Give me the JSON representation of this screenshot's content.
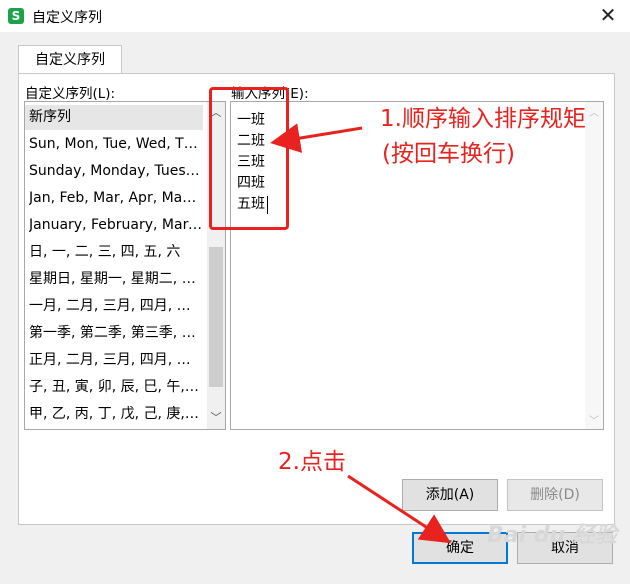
{
  "window": {
    "title": "自定义序列",
    "app_icon_glyph": "S"
  },
  "tabs": [
    {
      "label": "自定义序列"
    }
  ],
  "list_section": {
    "label": "自定义序列(L):",
    "items": [
      "新序列",
      "Sun, Mon, Tue, Wed, Thu, Fri, Sat",
      "Sunday, Monday, Tuesday, Wednesday, Thursday, Friday, Saturday",
      "Jan, Feb, Mar, Apr, May, Jun, Jul, Aug, Sep, Oct, Nov, Dec",
      "January, February, March, April, May, June, July, August, September, October, November, December",
      "日, 一, 二, 三, 四, 五, 六",
      "星期日, 星期一, 星期二, 星期三, 星期四, 星期五, 星期六",
      "一月, 二月, 三月, 四月, 五月, 六月, 七月, 八月, 九月, 十月, 十一月, 十二月",
      "第一季, 第二季, 第三季, 第四季",
      "正月, 二月, 三月, 四月, 五月, 六月, 七月, 八月, 九月, 十月, 冬月, 腊月",
      "子, 丑, 寅, 卯, 辰, 巳, 午, 未, 申, 酉, 戌, 亥",
      "甲, 乙, 丙, 丁, 戊, 己, 庚, 辛, 壬, 癸"
    ],
    "selected_index": 0
  },
  "input_section": {
    "label": "输入序列(E):",
    "lines": [
      "一班",
      "二班",
      "三班",
      "四班",
      "五班"
    ]
  },
  "buttons": {
    "add": "添加(A)",
    "delete": "删除(D)",
    "ok": "确定",
    "cancel": "取消"
  },
  "annotations": {
    "step1_line1": "1.顺序输入排序规矩",
    "step1_line2": "(按回车换行)",
    "step2": "2.点击",
    "color": "#e8231f"
  },
  "watermark": "Bai du 经验"
}
